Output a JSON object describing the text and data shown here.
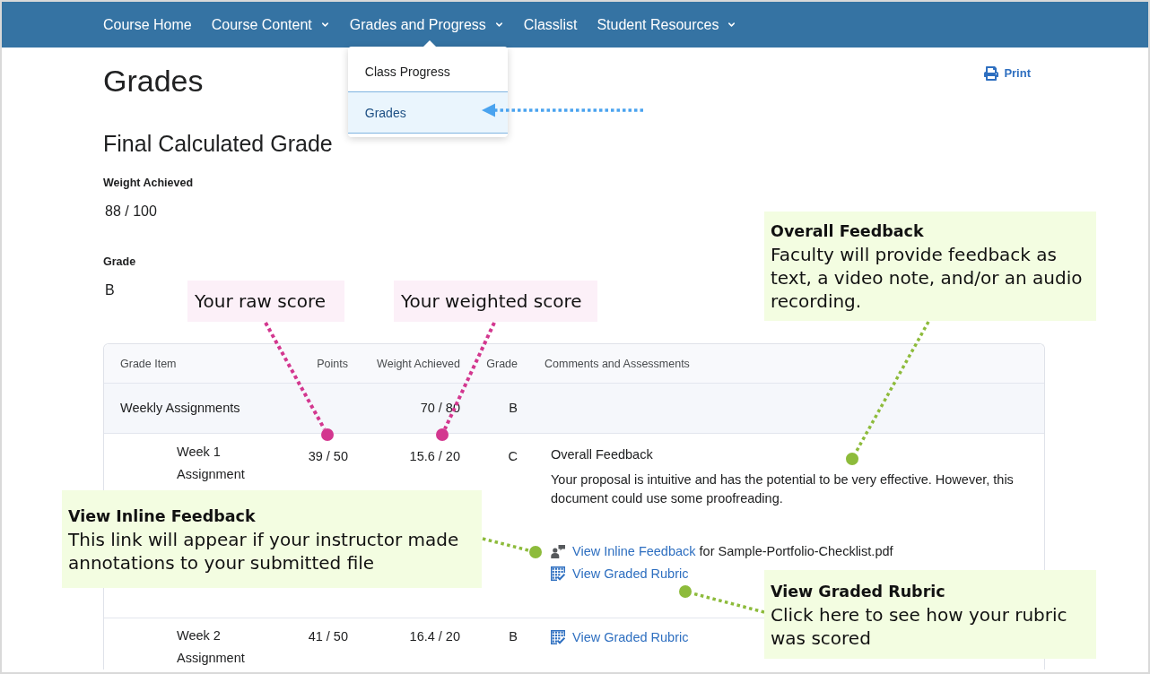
{
  "nav": {
    "items": [
      {
        "label": "Course Home",
        "kind": "link"
      },
      {
        "label": "Course Content",
        "kind": "menu"
      },
      {
        "label": "Grades and Progress",
        "kind": "menu",
        "menu": [
          {
            "label": "Class Progress",
            "selected": false
          },
          {
            "label": "Grades",
            "selected": true
          }
        ]
      },
      {
        "label": "Classlist",
        "kind": "link"
      },
      {
        "label": "Student Resources",
        "kind": "menu"
      }
    ]
  },
  "page": {
    "title": "Grades",
    "print_label": "Print"
  },
  "final_grade": {
    "heading": "Final Calculated Grade",
    "fields": [
      {
        "label": "Weight Achieved",
        "value": "88 / 100"
      },
      {
        "label": "Grade",
        "value": "B"
      }
    ]
  },
  "table": {
    "columns": [
      "Grade Item",
      "Points",
      "Weight Achieved",
      "Grade",
      "Comments and Assessments"
    ],
    "rows": [
      {
        "kind": "category",
        "item": "Weekly Assignments",
        "weight": "70 / 80",
        "grade": "B"
      },
      {
        "kind": "item",
        "item": "Week 1 Assignment",
        "points": "39 / 50",
        "weight": "15.6 / 20",
        "grade": "C",
        "feedback": {
          "heading": "Overall Feedback",
          "text": "Your proposal is intuitive and has the potential to be very effective. However, this document could use some proofreading."
        },
        "links": [
          {
            "kind": "inline_feedback",
            "label": "View Inline Feedback",
            "suffix": "for Sample-Portfolio-Checklist.pdf"
          },
          {
            "kind": "rubric",
            "label": "View Graded Rubric"
          }
        ]
      },
      {
        "kind": "item",
        "item": "Week 2 Assignment",
        "points": "41 / 50",
        "weight": "16.4 / 20",
        "grade": "B",
        "links": [
          {
            "kind": "rubric",
            "label": "View Graded Rubric"
          }
        ]
      }
    ]
  },
  "annotations": [
    {
      "kind": "label",
      "text": "Your raw score",
      "color": "#d3378f"
    },
    {
      "kind": "label",
      "text": "Your weighted score",
      "color": "#d3378f"
    },
    {
      "kind": "note",
      "title": "Overall Feedback",
      "text": "Faculty will provide feedback as text, a video note, and/or an audio recording.",
      "color": "#8dbb3b"
    },
    {
      "kind": "note",
      "title": "View Inline Feedback",
      "text": "This link will appear if your instructor made annotations to your submitted file",
      "color": "#8dbb3b"
    },
    {
      "kind": "note",
      "title": "View Graded Rubric",
      "text": "Click here to see how your rubric was scored",
      "color": "#8dbb3b"
    }
  ]
}
